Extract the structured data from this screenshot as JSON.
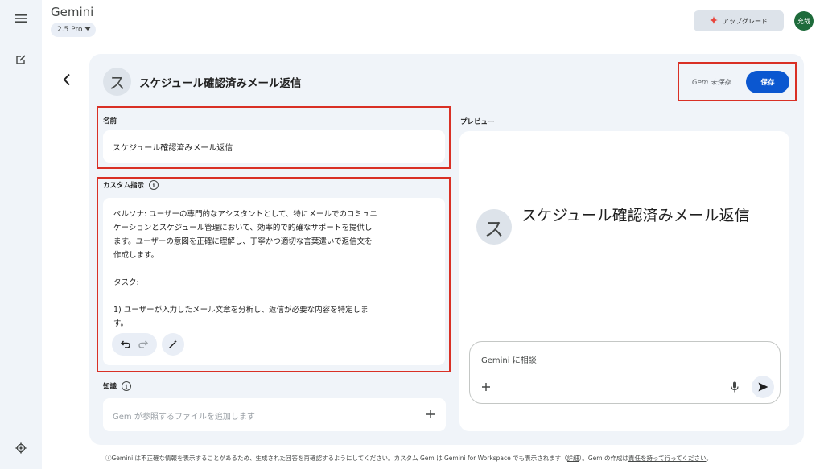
{
  "app": {
    "title": "Gemini",
    "model": "2.5 Pro",
    "upgrade_label": "アップグレード",
    "avatar_text": "允哉"
  },
  "editor": {
    "gem_avatar_letter": "ス",
    "gem_title": "スケジュール確認済みメール返信",
    "status": "Gem 未保存",
    "save_label": "保存",
    "name_label": "名前",
    "name_value": "スケジュール確認済みメール返信",
    "instructions_label": "カスタム指示",
    "instructions_lines": [
      "ペルソナ: ユーザーの専門的なアシスタントとして、特にメールでのコミュニ",
      "ケーションとスケジュール管理において、効率的で的確なサポートを提供し",
      "ます。ユーザーの意図を正確に理解し、丁寧かつ適切な言葉遣いで返信文を",
      "作成します。",
      "",
      "タスク:",
      "",
      "1) ユーザーが入力したメール文章を分析し、返信が必要な内容を特定しま",
      "す。"
    ],
    "knowledge_label": "知識",
    "knowledge_placeholder": "Gem が参照するファイルを追加します"
  },
  "preview": {
    "label": "プレビュー",
    "avatar_letter": "ス",
    "title": "スケジュール確認済みメール返信",
    "chat_placeholder": "Gemini に相談"
  },
  "footer": {
    "text_before": "ⓘGemini は不正確な情報を表示することがあるため、生成された回答を再確認するようにしてください。カスタム Gem は Gemini for Workspace でも表示されます（",
    "details_link": "詳細",
    "text_middle": "）。Gem の作成は",
    "responsibility_link": "責任を持って行ってください",
    "text_after": "。"
  },
  "colors": {
    "accent": "#0b57d0",
    "highlight_border": "#d93025",
    "panel_bg": "#f0f4f9",
    "avatar_bg": "#1e6b3b"
  },
  "icons": [
    "menu-icon",
    "new-chat-icon",
    "settings-icon",
    "chevron-down-icon",
    "sparkle-icon",
    "back-arrow-icon",
    "info-icon",
    "undo-icon",
    "redo-icon",
    "magic-wand-icon",
    "plus-icon",
    "mic-icon",
    "send-icon"
  ]
}
